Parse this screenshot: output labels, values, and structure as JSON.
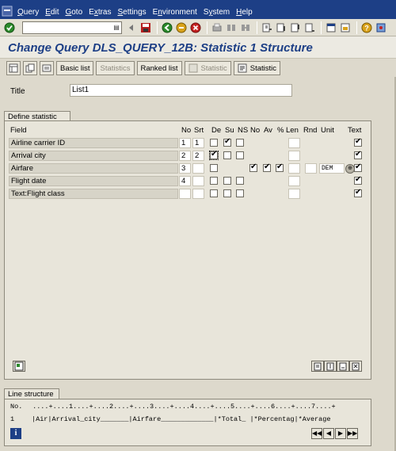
{
  "menu": {
    "items": [
      {
        "label": "Query",
        "ul": "Q",
        "rest": "uery"
      },
      {
        "label": "Edit",
        "ul": "E",
        "rest": "dit"
      },
      {
        "label": "Goto",
        "ul": "G",
        "rest": "oto"
      },
      {
        "label": "Extras",
        "ul": "x",
        "pre": "E",
        "rest": "tras"
      },
      {
        "label": "Settings",
        "ul": "S",
        "rest": "ettings"
      },
      {
        "label": "Environment",
        "ul": "n",
        "pre": "E",
        "rest": "vironment"
      },
      {
        "label": "System",
        "ul": "y",
        "pre": "S",
        "rest": "stem"
      },
      {
        "label": "Help",
        "ul": "H",
        "rest": "elp"
      }
    ]
  },
  "command_field": {
    "value": ""
  },
  "title": "Change Query DLS_QUERY_12B: Statistic 1 Structure",
  "app_toolbar": {
    "basic_list": "Basic list",
    "statistics": "Statistics",
    "ranked_list": "Ranked list",
    "statistic_disabled": "Statistic",
    "statistic": "Statistic"
  },
  "title_field": {
    "label": "Title",
    "value": "List1"
  },
  "define": {
    "tab": "Define statistic",
    "headers": {
      "field": "Field",
      "no": "No",
      "srt": "Srt",
      "de": "De",
      "su": "Su",
      "ns": "NS",
      "no2": "No",
      "av": "Av",
      "pct": "%",
      "len": "Len",
      "rnd": "Rnd",
      "unit": "Unit",
      "text": "Text"
    },
    "rows": [
      {
        "field": "Airline carrier ID",
        "no": "1",
        "srt": "1"
      },
      {
        "field": "Arrival city",
        "no": "2",
        "srt": "2"
      },
      {
        "field": "Airfare",
        "no": "3",
        "srt": "",
        "unit": "DEM"
      },
      {
        "field": "Flight date",
        "no": "4",
        "srt": ""
      },
      {
        "field": "Text:Flight class",
        "no": "",
        "srt": ""
      }
    ]
  },
  "line": {
    "tab": "Line structure",
    "ruler_label": "No.",
    "ruler": " ....+....1....+....2....+....3....+....4....+....5....+....6....+....7....+",
    "row_no": "1",
    "row_text": "|Air|Arrival_city_______|Airfare_____________|*Total_ |*Percentag|*Average"
  },
  "colors": {
    "menubar": "#1d3f86",
    "title": "#1d3f86",
    "background": "#ddd9cc"
  }
}
